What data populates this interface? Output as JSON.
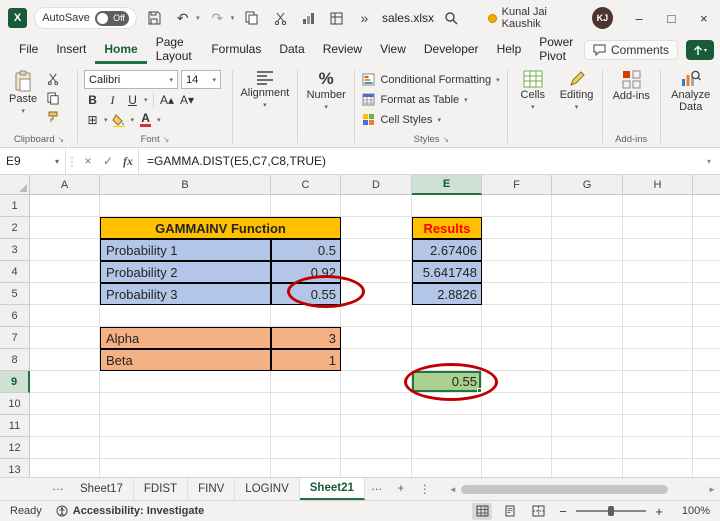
{
  "colors": {
    "accent_green": "#185C37",
    "selection_green": "#217346",
    "header_gold": "#FFC000",
    "input_blue": "#B4C6E7",
    "param_orange": "#F4B183",
    "result_green": "#A9D08E",
    "results_text_red": "#FF0000",
    "annotation_red": "#C00000"
  },
  "icons": {
    "excel_logo": "X",
    "undo": "↶",
    "redo": "↷",
    "dropdown": "▾",
    "overflow": "»",
    "minimize": "–",
    "maximize": "□",
    "close": "×",
    "cancel": "×",
    "check": "✓",
    "fx": "fx",
    "expand": "▾",
    "launcher": "↘",
    "more": "⋯",
    "vdots": "⋮",
    "plus": "+",
    "scroll_left": "◄",
    "scroll_right": "►",
    "bold": "B",
    "italic": "I",
    "underline": "U",
    "grow_font": "A▴",
    "shrink_font": "A▾",
    "font_color": "A",
    "borders": "⊞",
    "percent": "%"
  },
  "titlebar": {
    "autosave_label": "AutoSave",
    "autosave_state": "Off",
    "filename": "sales.xlsx",
    "user_name": "Kunal Jai Kaushik",
    "user_initials": "KJ"
  },
  "menubar": {
    "tabs": [
      {
        "label": "File"
      },
      {
        "label": "Insert"
      },
      {
        "label": "Home"
      },
      {
        "label": "Page Layout"
      },
      {
        "label": "Formulas"
      },
      {
        "label": "Data"
      },
      {
        "label": "Review"
      },
      {
        "label": "View"
      },
      {
        "label": "Developer"
      },
      {
        "label": "Help"
      },
      {
        "label": "Power Pivot"
      }
    ],
    "active_tab": "Home",
    "comments_label": "Comments"
  },
  "ribbon": {
    "paste": "Paste",
    "clipboard_group": "Clipboard",
    "font_name": "Calibri",
    "font_size": "14",
    "font_group": "Font",
    "alignment": "Alignment",
    "number": "Number",
    "conditional_formatting": "Conditional Formatting",
    "format_as_table": "Format as Table",
    "cell_styles": "Cell Styles",
    "styles_group": "Styles",
    "cells": "Cells",
    "editing": "Editing",
    "addins_button": "Add-ins",
    "addins_group": "Add-ins",
    "analyze_data": "Analyze Data"
  },
  "formula_bar": {
    "cell_ref": "E9",
    "formula": "=GAMMA.DIST(E5,C7,C8,TRUE)"
  },
  "grid": {
    "column_headers": [
      "A",
      "B",
      "C",
      "D",
      "E",
      "F",
      "G",
      "H"
    ],
    "row_headers": [
      "1",
      "2",
      "3",
      "4",
      "5",
      "6",
      "7",
      "8",
      "9",
      "10",
      "11",
      "12",
      "13"
    ],
    "selected_column": "E",
    "selected_row": "9",
    "selected_cell": "E9",
    "cells": {
      "b2": "GAMMAINV Function",
      "e2": "Results",
      "b3": "Probability 1",
      "c3": "0.5",
      "e3": "2.67406",
      "b4": "Probability 2",
      "c4": "0.92",
      "e4": "5.641748",
      "b5": "Probability 3",
      "c5": "0.55",
      "e5": "2.8826",
      "b7": "Alpha",
      "c7": "3",
      "b8": "Beta",
      "c8": "1",
      "e9": "0.55"
    }
  },
  "sheet_tabs": {
    "tabs": [
      {
        "label": "Sheet17"
      },
      {
        "label": "FDIST"
      },
      {
        "label": "FINV"
      },
      {
        "label": "LOGINV"
      },
      {
        "label": "Sheet21"
      }
    ],
    "active_tab": "Sheet21"
  },
  "status_bar": {
    "ready": "Ready",
    "accessibility": "Accessibility: Investigate",
    "zoom": "100%"
  }
}
